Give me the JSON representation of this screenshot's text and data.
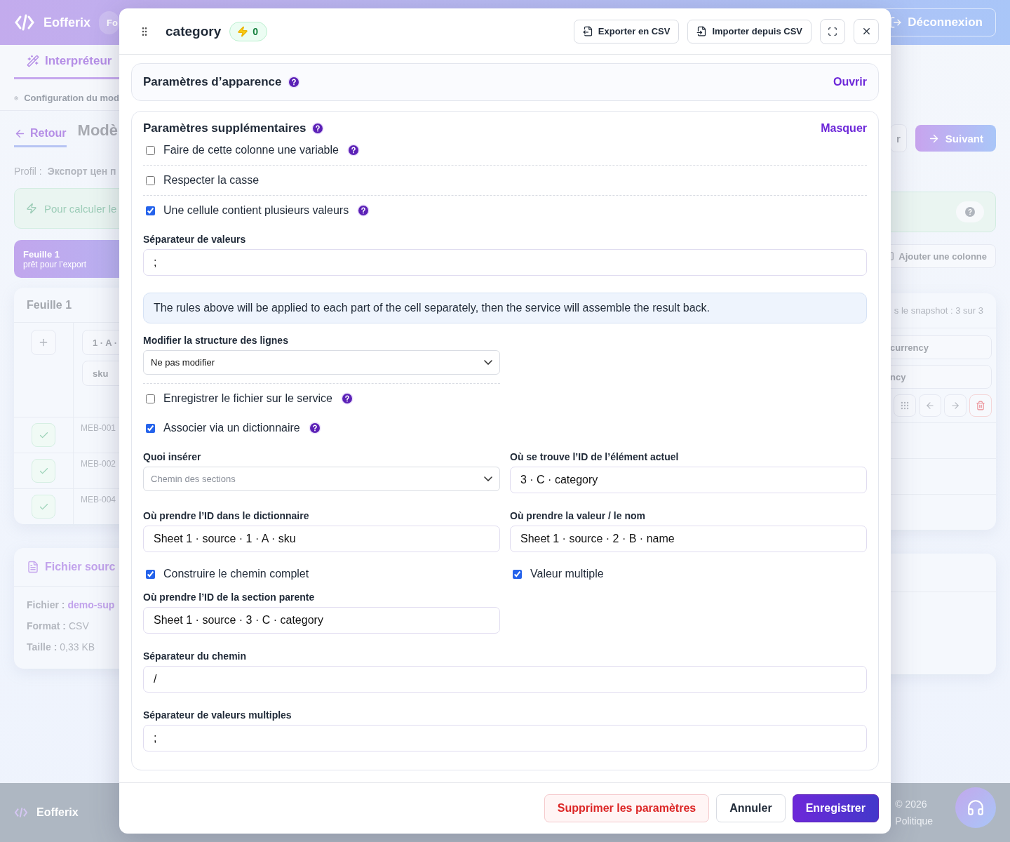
{
  "background": {
    "brand": "Eofferix",
    "header_tab": "Fo",
    "logout": "Déconnexion",
    "nav_tab": {
      "label": "Interpréteur",
      "selected": true
    },
    "config_label": "Configuration du mod",
    "back": "Retour",
    "page_title": "Modè",
    "profile": {
      "label": "Profil :",
      "value": "Экспорт цен п"
    },
    "prev_button": "r",
    "next_button": "Suivant",
    "tip": "Pour calculer le",
    "sheet_tab": {
      "title": "Feuille 1",
      "subtitle": "prêt pour l’export",
      "selected": true
    },
    "add_column": "Ajouter une colonne",
    "sheet_card": {
      "title": "Feuille 1",
      "snapshot": "s le snapshot : 3 sur 3",
      "left_headers": [
        "1 · A ·",
        "sku"
      ],
      "right_headers": [
        "currency",
        "ncy"
      ],
      "rows": [
        {
          "checked": true,
          "value": "MEB-001"
        },
        {
          "checked": true,
          "value": "MEB-002"
        },
        {
          "checked": true,
          "value": "MEB-004"
        }
      ]
    },
    "source_card": {
      "title": "Fichier sourc",
      "fields": [
        {
          "label": "Fichier :",
          "value": "demo-sup",
          "link": true
        },
        {
          "label": "Format :",
          "value": "CSV",
          "link": false
        },
        {
          "label": "Taille :",
          "value": "0,33 KB",
          "link": false
        }
      ]
    },
    "footer": {
      "brand": "Eofferix",
      "copyright": "© 2026",
      "policy": "Politique"
    }
  },
  "modal": {
    "title": "category",
    "badge": "0",
    "actions": [
      "Exporter en CSV",
      "Importer depuis CSV"
    ],
    "sections": [
      {
        "title": "Paramètres d’apparence",
        "action": "Ouvrir",
        "expanded": false
      },
      {
        "title": "Paramètres supplémentaires",
        "action": "Masquer",
        "expanded": true,
        "fields": [
          {
            "kind": "checkbox",
            "label": "Faire de cette colonne une variable",
            "checked": false,
            "help": true,
            "divided": true
          },
          {
            "kind": "checkbox",
            "label": "Respecter la casse",
            "checked": false,
            "help": false,
            "divided": true
          },
          {
            "kind": "checkbox",
            "label": "Une cellule contient plusieurs valeurs",
            "checked": true,
            "help": true,
            "divided": false
          },
          {
            "kind": "input",
            "label": "Séparateur de valeurs",
            "value": ";",
            "half": false
          },
          {
            "kind": "note",
            "text": "The rules above will be applied to each part of the cell separately, then the service will assemble the result back."
          },
          {
            "kind": "select",
            "label": "Modifier la structure des lignes",
            "value": "Ne pas modifier",
            "half": true,
            "divided": true
          },
          {
            "kind": "checkbox",
            "label": "Enregistrer le fichier sur le service",
            "checked": false,
            "help": true,
            "divided": false
          },
          {
            "kind": "checkbox",
            "label": "Associer via un dictionnaire",
            "checked": true,
            "help": true,
            "divided": false
          },
          {
            "kind": "row",
            "items": [
              {
                "kind": "select",
                "label": "Quoi insérer",
                "placeholder": "Chemin des sections"
              },
              {
                "kind": "input",
                "label": "Où se trouve l’ID de l’élément actuel",
                "value": "3 · C · category"
              }
            ]
          },
          {
            "kind": "row",
            "items": [
              {
                "kind": "input",
                "label": "Où prendre l’ID dans le dictionnaire",
                "value": "Sheet 1 · source · 1 · A · sku"
              },
              {
                "kind": "input",
                "label": "Où prendre la valeur / le nom",
                "value": "Sheet 1 · source · 2 · B · name"
              }
            ]
          },
          {
            "kind": "row",
            "items": [
              {
                "kind": "checkbox",
                "label": "Construire le chemin complet",
                "checked": true,
                "help": false
              },
              {
                "kind": "checkbox",
                "label": "Valeur multiple",
                "checked": true,
                "help": false
              }
            ]
          },
          {
            "kind": "input",
            "label": "Où prendre l’ID de la section parente",
            "value": "Sheet 1 · source · 3 · C · category",
            "half": true
          },
          {
            "kind": "input",
            "label": "Séparateur du chemin",
            "value": "/",
            "half": false
          },
          {
            "kind": "input",
            "label": "Séparateur de valeurs multiples",
            "value": ";",
            "half": false
          }
        ]
      }
    ],
    "footer_buttons": [
      {
        "label": "Supprimer les paramètres",
        "kind": "danger"
      },
      {
        "label": "Annuler",
        "kind": "secondary"
      },
      {
        "label": "Enregistrer",
        "kind": "primary"
      }
    ]
  }
}
